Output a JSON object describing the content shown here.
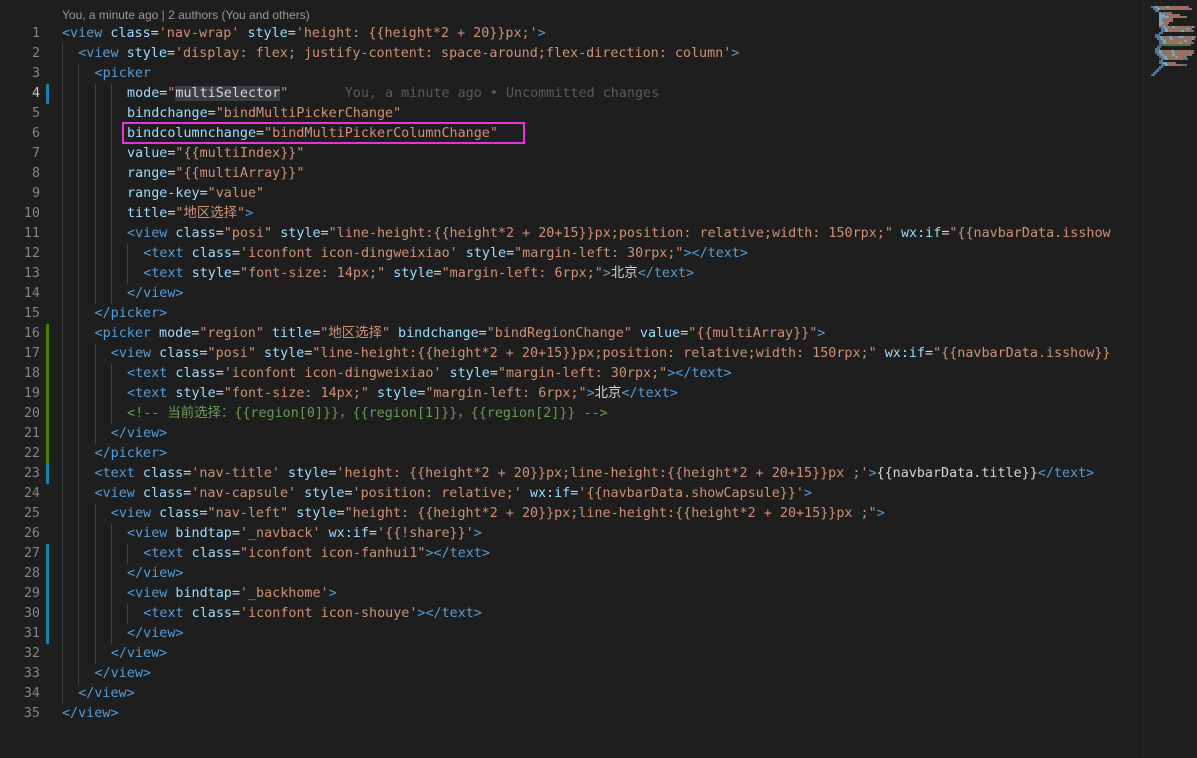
{
  "codelens": "You, a minute ago | 2 authors (You and others)",
  "blame_text": "You, a minute ago • Uncommitted changes",
  "lines": [
    {
      "n": "1",
      "indent": 0,
      "mark": "",
      "tokens": [
        [
          "tag",
          "<view"
        ],
        [
          "txt",
          " "
        ],
        [
          "attr",
          "class"
        ],
        [
          "txt",
          "="
        ],
        [
          "str",
          "'nav-wrap'"
        ],
        [
          "txt",
          " "
        ],
        [
          "attr",
          "style"
        ],
        [
          "txt",
          "="
        ],
        [
          "str",
          "'height: {{height*2 + 20}}px;'"
        ],
        [
          "tag",
          ">"
        ]
      ]
    },
    {
      "n": "2",
      "indent": 1,
      "mark": "",
      "tokens": [
        [
          "tag",
          "<view"
        ],
        [
          "txt",
          " "
        ],
        [
          "attr",
          "style"
        ],
        [
          "txt",
          "="
        ],
        [
          "str",
          "'display: flex; justify-content: space-around;flex-direction: column'"
        ],
        [
          "tag",
          ">"
        ]
      ]
    },
    {
      "n": "3",
      "indent": 2,
      "mark": "",
      "tokens": [
        [
          "tag",
          "<picker"
        ]
      ]
    },
    {
      "n": "4",
      "indent": 4,
      "mark": "mod",
      "active": true,
      "tokens": [
        [
          "attr",
          "mode"
        ],
        [
          "txt",
          "="
        ],
        [
          "str",
          "\""
        ],
        [
          "hl",
          "multiSelector"
        ],
        [
          "str",
          "\""
        ]
      ],
      "blame": true
    },
    {
      "n": "5",
      "indent": 4,
      "mark": "",
      "tokens": [
        [
          "attr",
          "bindchange"
        ],
        [
          "txt",
          "="
        ],
        [
          "str",
          "\"bindMultiPickerChange\""
        ]
      ]
    },
    {
      "n": "6",
      "indent": 4,
      "mark": "",
      "tokens": [
        [
          "attr",
          "bindcolumnchange"
        ],
        [
          "txt",
          "="
        ],
        [
          "str",
          "\"bindMultiPickerColumnChange\""
        ]
      ]
    },
    {
      "n": "7",
      "indent": 4,
      "mark": "",
      "tokens": [
        [
          "attr",
          "value"
        ],
        [
          "txt",
          "="
        ],
        [
          "str",
          "\"{{multiIndex}}\""
        ]
      ]
    },
    {
      "n": "8",
      "indent": 4,
      "mark": "",
      "tokens": [
        [
          "attr",
          "range"
        ],
        [
          "txt",
          "="
        ],
        [
          "str",
          "\"{{multiArray}}\""
        ]
      ]
    },
    {
      "n": "9",
      "indent": 4,
      "mark": "",
      "tokens": [
        [
          "attr",
          "range-key"
        ],
        [
          "txt",
          "="
        ],
        [
          "str",
          "\"value\""
        ]
      ]
    },
    {
      "n": "10",
      "indent": 4,
      "mark": "",
      "tokens": [
        [
          "attr",
          "title"
        ],
        [
          "txt",
          "="
        ],
        [
          "str",
          "\"地区选择\""
        ],
        [
          "tag",
          ">"
        ]
      ]
    },
    {
      "n": "11",
      "indent": 4,
      "mark": "",
      "tokens": [
        [
          "tag",
          "<view"
        ],
        [
          "txt",
          " "
        ],
        [
          "attr",
          "class"
        ],
        [
          "txt",
          "="
        ],
        [
          "str",
          "\"posi\""
        ],
        [
          "txt",
          " "
        ],
        [
          "attr",
          "style"
        ],
        [
          "txt",
          "="
        ],
        [
          "str",
          "\"line-height:{{height*2 + 20+15}}px;position: relative;width: 150rpx;\""
        ],
        [
          "txt",
          " "
        ],
        [
          "attr",
          "wx:if"
        ],
        [
          "txt",
          "="
        ],
        [
          "str",
          "\"{{navbarData.isshow"
        ]
      ]
    },
    {
      "n": "12",
      "indent": 5,
      "mark": "",
      "tokens": [
        [
          "tag",
          "<text"
        ],
        [
          "txt",
          " "
        ],
        [
          "attr",
          "class"
        ],
        [
          "txt",
          "="
        ],
        [
          "str",
          "'iconfont icon-dingweixiao'"
        ],
        [
          "txt",
          " "
        ],
        [
          "attr",
          "style"
        ],
        [
          "txt",
          "="
        ],
        [
          "str",
          "\"margin-left: 30rpx;\""
        ],
        [
          "tag",
          "></text>"
        ]
      ]
    },
    {
      "n": "13",
      "indent": 5,
      "mark": "",
      "tokens": [
        [
          "tag",
          "<text"
        ],
        [
          "txt",
          " "
        ],
        [
          "attr",
          "style"
        ],
        [
          "txt",
          "="
        ],
        [
          "str",
          "\"font-size: 14px;\""
        ],
        [
          "txt",
          " "
        ],
        [
          "attr",
          "style"
        ],
        [
          "txt",
          "="
        ],
        [
          "str",
          "\"margin-left: 6rpx;\""
        ],
        [
          "tag",
          ">"
        ],
        [
          "txt",
          "北京"
        ],
        [
          "tag",
          "</text>"
        ]
      ]
    },
    {
      "n": "14",
      "indent": 4,
      "mark": "",
      "tokens": [
        [
          "tag",
          "</view>"
        ]
      ]
    },
    {
      "n": "15",
      "indent": 2,
      "mark": "",
      "tokens": [
        [
          "tag",
          "</picker>"
        ]
      ]
    },
    {
      "n": "16",
      "indent": 2,
      "mark": "add",
      "tokens": [
        [
          "tag",
          "<picker"
        ],
        [
          "txt",
          " "
        ],
        [
          "attr",
          "mode"
        ],
        [
          "txt",
          "="
        ],
        [
          "str",
          "\"region\""
        ],
        [
          "txt",
          " "
        ],
        [
          "attr",
          "title"
        ],
        [
          "txt",
          "="
        ],
        [
          "str",
          "\"地区选择\""
        ],
        [
          "txt",
          " "
        ],
        [
          "attr",
          "bindchange"
        ],
        [
          "txt",
          "="
        ],
        [
          "str",
          "\"bindRegionChange\""
        ],
        [
          "txt",
          " "
        ],
        [
          "attr",
          "value"
        ],
        [
          "txt",
          "="
        ],
        [
          "str",
          "\"{{multiArray}}\""
        ],
        [
          "tag",
          ">"
        ]
      ]
    },
    {
      "n": "17",
      "indent": 3,
      "mark": "add",
      "tokens": [
        [
          "tag",
          "<view"
        ],
        [
          "txt",
          " "
        ],
        [
          "attr",
          "class"
        ],
        [
          "txt",
          "="
        ],
        [
          "str",
          "\"posi\""
        ],
        [
          "txt",
          " "
        ],
        [
          "attr",
          "style"
        ],
        [
          "txt",
          "="
        ],
        [
          "str",
          "\"line-height:{{height*2 + 20+15}}px;position: relative;width: 150rpx;\""
        ],
        [
          "txt",
          " "
        ],
        [
          "attr",
          "wx:if"
        ],
        [
          "txt",
          "="
        ],
        [
          "str",
          "\"{{navbarData.isshow}}"
        ]
      ]
    },
    {
      "n": "18",
      "indent": 4,
      "mark": "add",
      "tokens": [
        [
          "tag",
          "<text"
        ],
        [
          "txt",
          " "
        ],
        [
          "attr",
          "class"
        ],
        [
          "txt",
          "="
        ],
        [
          "str",
          "'iconfont icon-dingweixiao'"
        ],
        [
          "txt",
          " "
        ],
        [
          "attr",
          "style"
        ],
        [
          "txt",
          "="
        ],
        [
          "str",
          "\"margin-left: 30rpx;\""
        ],
        [
          "tag",
          "></text>"
        ]
      ]
    },
    {
      "n": "19",
      "indent": 4,
      "mark": "add",
      "tokens": [
        [
          "tag",
          "<text"
        ],
        [
          "txt",
          " "
        ],
        [
          "attr",
          "style"
        ],
        [
          "txt",
          "="
        ],
        [
          "str",
          "\"font-size: 14px;\""
        ],
        [
          "txt",
          " "
        ],
        [
          "attr",
          "style"
        ],
        [
          "txt",
          "="
        ],
        [
          "str",
          "\"margin-left: 6rpx;\""
        ],
        [
          "tag",
          ">"
        ],
        [
          "txt",
          "北京"
        ],
        [
          "tag",
          "</text>"
        ]
      ]
    },
    {
      "n": "20",
      "indent": 4,
      "mark": "add",
      "tokens": [
        [
          "cmt",
          "<!-- 当前选择：{{region[0]}}，{{region[1]}}，{{region[2]}} -->"
        ]
      ]
    },
    {
      "n": "21",
      "indent": 3,
      "mark": "add",
      "tokens": [
        [
          "tag",
          "</view>"
        ]
      ]
    },
    {
      "n": "22",
      "indent": 2,
      "mark": "add",
      "tokens": [
        [
          "tag",
          "</picker>"
        ]
      ]
    },
    {
      "n": "23",
      "indent": 2,
      "mark": "mod",
      "tokens": [
        [
          "tag",
          "<text"
        ],
        [
          "txt",
          " "
        ],
        [
          "attr",
          "class"
        ],
        [
          "txt",
          "="
        ],
        [
          "str",
          "'nav-title'"
        ],
        [
          "txt",
          " "
        ],
        [
          "attr",
          "style"
        ],
        [
          "txt",
          "="
        ],
        [
          "str",
          "'height: {{height*2 + 20}}px;line-height:{{height*2 + 20+15}}px ;'"
        ],
        [
          "tag",
          ">"
        ],
        [
          "txt",
          "{{navbarData.title}}"
        ],
        [
          "tag",
          "</text>"
        ]
      ]
    },
    {
      "n": "24",
      "indent": 2,
      "mark": "",
      "tokens": [
        [
          "tag",
          "<view"
        ],
        [
          "txt",
          " "
        ],
        [
          "attr",
          "class"
        ],
        [
          "txt",
          "="
        ],
        [
          "str",
          "'nav-capsule'"
        ],
        [
          "txt",
          " "
        ],
        [
          "attr",
          "style"
        ],
        [
          "txt",
          "="
        ],
        [
          "str",
          "'position: relative;'"
        ],
        [
          "txt",
          " "
        ],
        [
          "attr",
          "wx:if"
        ],
        [
          "txt",
          "="
        ],
        [
          "str",
          "'{{navbarData.showCapsule}}'"
        ],
        [
          "tag",
          ">"
        ]
      ]
    },
    {
      "n": "25",
      "indent": 3,
      "mark": "",
      "tokens": [
        [
          "tag",
          "<view"
        ],
        [
          "txt",
          " "
        ],
        [
          "attr",
          "class"
        ],
        [
          "txt",
          "="
        ],
        [
          "str",
          "\"nav-left\""
        ],
        [
          "txt",
          " "
        ],
        [
          "attr",
          "style"
        ],
        [
          "txt",
          "="
        ],
        [
          "str",
          "\"height: {{height*2 + 20}}px;line-height:{{height*2 + 20+15}}px ;\""
        ],
        [
          "tag",
          ">"
        ]
      ]
    },
    {
      "n": "26",
      "indent": 4,
      "mark": "",
      "tokens": [
        [
          "tag",
          "<view"
        ],
        [
          "txt",
          " "
        ],
        [
          "attr",
          "bindtap"
        ],
        [
          "txt",
          "="
        ],
        [
          "str",
          "'_navback'"
        ],
        [
          "txt",
          " "
        ],
        [
          "attr",
          "wx:if"
        ],
        [
          "txt",
          "="
        ],
        [
          "str",
          "'{{!share}}'"
        ],
        [
          "tag",
          ">"
        ]
      ]
    },
    {
      "n": "27",
      "indent": 5,
      "mark": "mod",
      "tokens": [
        [
          "tag",
          "<text"
        ],
        [
          "txt",
          " "
        ],
        [
          "attr",
          "class"
        ],
        [
          "txt",
          "="
        ],
        [
          "str",
          "\"iconfont icon-fanhui1\""
        ],
        [
          "tag",
          "></text>"
        ]
      ]
    },
    {
      "n": "28",
      "indent": 4,
      "mark": "mod",
      "tokens": [
        [
          "tag",
          "</view>"
        ]
      ]
    },
    {
      "n": "29",
      "indent": 4,
      "mark": "mod",
      "tokens": [
        [
          "tag",
          "<view"
        ],
        [
          "txt",
          " "
        ],
        [
          "attr",
          "bindtap"
        ],
        [
          "txt",
          "="
        ],
        [
          "str",
          "'_backhome'"
        ],
        [
          "tag",
          ">"
        ]
      ]
    },
    {
      "n": "30",
      "indent": 5,
      "mark": "mod",
      "tokens": [
        [
          "tag",
          "<text"
        ],
        [
          "txt",
          " "
        ],
        [
          "attr",
          "class"
        ],
        [
          "txt",
          "="
        ],
        [
          "str",
          "'iconfont icon-shouye'"
        ],
        [
          "tag",
          "></text>"
        ]
      ]
    },
    {
      "n": "31",
      "indent": 4,
      "mark": "mod",
      "tokens": [
        [
          "tag",
          "</view>"
        ]
      ]
    },
    {
      "n": "32",
      "indent": 3,
      "mark": "",
      "tokens": [
        [
          "tag",
          "</view>"
        ]
      ]
    },
    {
      "n": "33",
      "indent": 2,
      "mark": "",
      "tokens": [
        [
          "tag",
          "</view>"
        ]
      ]
    },
    {
      "n": "34",
      "indent": 1,
      "mark": "",
      "tokens": [
        [
          "tag",
          "</view>"
        ]
      ]
    },
    {
      "n": "35",
      "indent": 0,
      "mark": "",
      "tokens": [
        [
          "tag",
          "</view>"
        ]
      ]
    }
  ],
  "colors": {
    "highlight_box": "#e236d9",
    "git_modified": "#1b81a8",
    "git_added": "#487e02"
  }
}
